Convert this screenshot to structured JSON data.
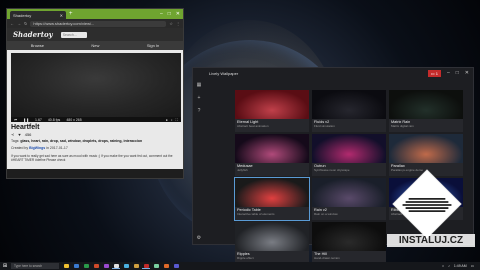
{
  "browser": {
    "tab_title": "Shadertoy",
    "url": "https://www.shadertoy.com/view/...",
    "site": {
      "logo": "Shadertoy",
      "search_placeholder": "Search...",
      "nav": [
        "Browse",
        "New",
        "Sign In"
      ]
    },
    "player": {
      "time": "1.67",
      "fps": "40.8 fps",
      "resolution": "480 x 265"
    },
    "shader": {
      "title": "Heartfelt",
      "likes": "456",
      "tags_label": "Tags:",
      "tags": "glass, heart, rain, drop, sad, window, droplets, drops, raining, interaccion",
      "created_prefix": "Created by",
      "author": "BigWings",
      "created_suffix": "in 2017-01-17",
      "description": "If you want to really get sad here as sure as mood with music ;) If you make the you want fed out, comment out the #HEART TIMER #define Please check"
    }
  },
  "lively": {
    "title": "Lively Wallpaper",
    "monitor_label": "1",
    "wallpapers": [
      {
        "name": "Eternal Light",
        "desc": "Abstract beat animation",
        "colors": [
          "#5a0d14",
          "#c0404a"
        ]
      },
      {
        "name": "Fluids v2",
        "desc": "Fluid simulation",
        "colors": [
          "#0b0b10",
          "#26262e"
        ]
      },
      {
        "name": "Matrix Rain",
        "desc": "Matrix digital rain",
        "colors": [
          "#0d0f0d",
          "#22302a"
        ]
      },
      {
        "name": "Medusae",
        "desc": "Jellyfish",
        "colors": [
          "#150a1a",
          "#b04a7a"
        ]
      },
      {
        "name": "Outrun",
        "desc": "Synthwave neon cityscape",
        "colors": [
          "#120f2a",
          "#b22a6e"
        ]
      },
      {
        "name": "Parallax",
        "desc": "Parallax.js engine demo",
        "colors": [
          "#1e2a3a",
          "#c06a4a"
        ]
      },
      {
        "name": "Periodic Table",
        "desc": "Interactive table of elements",
        "colors": [
          "#1a1a1a",
          "#e04040"
        ]
      },
      {
        "name": "Rain v2",
        "desc": "Rain on a window",
        "colors": [
          "#1a1f2a",
          "#5a4a6a"
        ]
      },
      {
        "name": "Ribbon",
        "desc": "Abstract ribbon",
        "colors": [
          "#0a0f3a",
          "#3a6ad0"
        ]
      },
      {
        "name": "Ripples",
        "desc": "Ripple effect",
        "colors": [
          "#202226",
          "#7a7d84"
        ]
      },
      {
        "name": "The Hill",
        "desc": "Hand-drawn terrain",
        "colors": [
          "#0d0d0d",
          "#2a2a2a"
        ]
      }
    ]
  },
  "taskbar": {
    "search_placeholder": "Type here to search",
    "time": "1:49 AM",
    "apps": [
      {
        "color": "#f0c030"
      },
      {
        "color": "#3a7ad0"
      },
      {
        "color": "#2a9a4a"
      },
      {
        "color": "#d04a2a"
      },
      {
        "color": "#9a4ad0"
      },
      {
        "color": "#e0e0e0"
      },
      {
        "color": "#4ab0e0"
      },
      {
        "color": "#d0a040"
      },
      {
        "color": "#c02a2a"
      },
      {
        "color": "#7ad0a0"
      },
      {
        "color": "#e06a2a"
      },
      {
        "color": "#5a5ad0"
      }
    ]
  },
  "watermark": {
    "text": "INSTALUJ.CZ"
  },
  "colors": {
    "browser_chrome": "#6fa430",
    "lively_bg": "#1d1e22",
    "lively_monitor_btn": "#c42b2b"
  }
}
